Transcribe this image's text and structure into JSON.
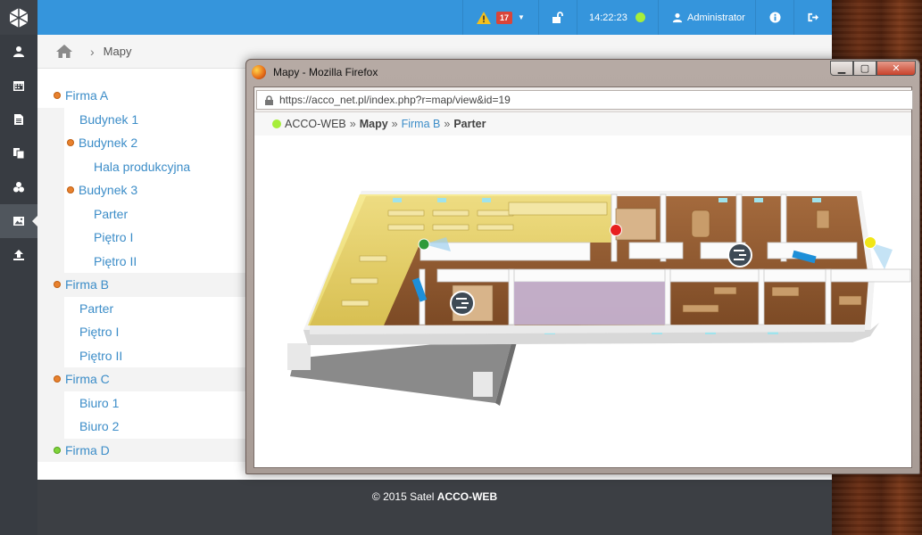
{
  "topbar": {
    "alert_count": "17",
    "time": "14:22:23",
    "user": "Administrator"
  },
  "breadcrumb": {
    "current": "Mapy"
  },
  "tree": {
    "firma_a": "Firma A",
    "budynek_1": "Budynek 1",
    "budynek_2": "Budynek 2",
    "hala": "Hala produkcyjna",
    "budynek_3": "Budynek 3",
    "b3_parter": "Parter",
    "b3_pietro1": "Piętro I",
    "b3_pietro2": "Piętro II",
    "firma_b": "Firma B",
    "fb_parter": "Parter",
    "fb_pietro1": "Piętro I",
    "fb_pietro2": "Piętro II",
    "firma_c": "Firma C",
    "biuro_1": "Biuro 1",
    "biuro_2": "Biuro 2",
    "firma_d": "Firma D"
  },
  "footer": {
    "copyright": "© 2015 Satel ",
    "brand": "ACCO-WEB"
  },
  "firefox": {
    "title": "Mapy - Mozilla Firefox",
    "url": "https://acco_net.pl/index.php?r=map/view&id=19",
    "crumb_root": "ACCO-WEB",
    "crumb_maps": "Mapy",
    "crumb_company": "Firma B",
    "crumb_floor": "Parter"
  },
  "colors": {
    "topbar": "#3595dc",
    "sidebar": "#383c42",
    "link": "#3c8dc8",
    "ok": "#a6ee3a"
  },
  "icons": [
    "user-icon",
    "calendar-icon",
    "document-icon",
    "copy-icon",
    "group-icon",
    "image-icon",
    "upload-icon",
    "home-icon",
    "warning-icon",
    "unlock-icon",
    "info-icon",
    "logout-icon"
  ]
}
